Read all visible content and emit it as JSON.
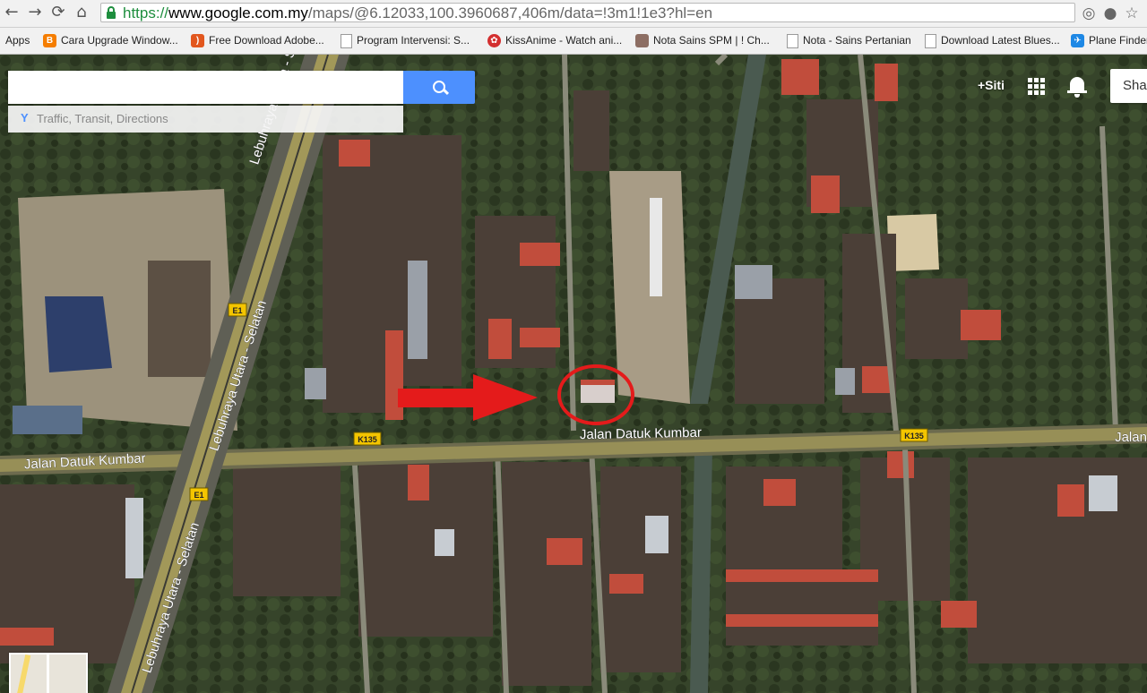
{
  "browser": {
    "url": {
      "protocol": "https://",
      "host": "www.google.com.my",
      "path": "/maps/@6.12033,100.3960687,406m/data=!3m1!1e3?hl=en"
    },
    "nav": {
      "back": "←",
      "forward": "→",
      "reload": "⟳",
      "home": "⌂"
    },
    "extensions": {
      "location": "◎",
      "bulb": "●",
      "star": "☆"
    },
    "apps_label": "Apps",
    "bookmarks": [
      {
        "label": "Cara Upgrade Window...",
        "icon": "blogger-icon",
        "color": "#f57d00"
      },
      {
        "label": "Free Download Adobe...",
        "icon": "rss-icon",
        "color": "#e2571e"
      },
      {
        "label": "Program Intervensi: S...",
        "icon": "page-icon",
        "color": "#ffffff"
      },
      {
        "label": "KissAnime - Watch ani...",
        "icon": "kissanime-icon",
        "color": "#d32f2f"
      },
      {
        "label": "Nota Sains SPM | ! Ch...",
        "icon": "avatar-icon",
        "color": "#8d6e63"
      },
      {
        "label": "Nota - Sains Pertanian",
        "icon": "page-icon",
        "color": "#ffffff"
      },
      {
        "label": "Download Latest Blues...",
        "icon": "page-icon",
        "color": "#ffffff"
      },
      {
        "label": "Plane Finder",
        "icon": "plane-icon",
        "color": "#1e88e5"
      }
    ]
  },
  "maps": {
    "search_placeholder": "",
    "directions_text": "Traffic, Transit, Directions",
    "user_label": "+Siti",
    "share_label": "Shar",
    "accent_color": "#4d90fe"
  },
  "map_labels": {
    "highway": "Lebuhraya Utara - Selatan",
    "road_main": "Jalan Datuk Kumbar",
    "road_right": "Jalan",
    "route_e1": "E1",
    "route_k135": "K135"
  },
  "annotation": {
    "arrow_color": "#e41b1b",
    "circle_color": "#e41b1b"
  }
}
